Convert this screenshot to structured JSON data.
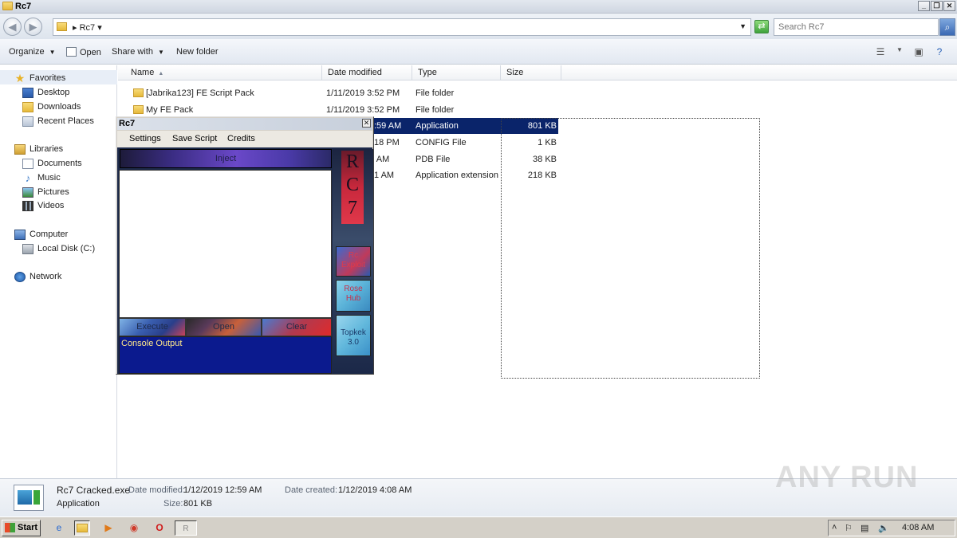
{
  "window": {
    "title": "Rc7"
  },
  "address": {
    "path": "Rc7",
    "search_placeholder": "Search Rc7"
  },
  "toolbar": {
    "organize": "Organize",
    "open": "Open",
    "share_with": "Share with",
    "new_folder": "New folder"
  },
  "nav": {
    "favorites": "Favorites",
    "desktop": "Desktop",
    "downloads": "Downloads",
    "recent": "Recent Places",
    "libraries": "Libraries",
    "documents": "Documents",
    "music": "Music",
    "pictures": "Pictures",
    "videos": "Videos",
    "computer": "Computer",
    "local_disk": "Local Disk (C:)",
    "network": "Network"
  },
  "columns": {
    "name": "Name",
    "date": "Date modified",
    "type": "Type",
    "size": "Size"
  },
  "files": [
    {
      "name": "[Jabrika123] FE Script Pack",
      "date": "1/11/2019 3:52 PM",
      "type": "File folder",
      "size": ""
    },
    {
      "name": "My FE Pack",
      "date": "1/11/2019 3:52 PM",
      "type": "File folder",
      "size": ""
    },
    {
      "name": "",
      "date": ":59 AM",
      "type": "Application",
      "size": "801 KB"
    },
    {
      "name": "",
      "date": "18 PM",
      "type": "CONFIG File",
      "size": "1 KB"
    },
    {
      "name": "",
      "date": ":59 AM",
      "type": "PDB File",
      "size": "38 KB"
    },
    {
      "name": "",
      "date": "1 AM",
      "type": "Application extension",
      "size": "218 KB"
    }
  ],
  "details": {
    "filename": "Rc7 Cracked.exe",
    "filetype": "Application",
    "date_modified_label": "Date modified:",
    "date_modified": "1/12/2019 12:59 AM",
    "date_created_label": "Date created:",
    "date_created": "1/12/2019 4:08 AM",
    "size_label": "Size:",
    "size": "801 KB"
  },
  "watermark": "ANY RUN",
  "taskbar": {
    "start": "Start",
    "clock": "4:08 AM",
    "rc7_task": "R"
  },
  "rc7": {
    "title": "Rc7",
    "menu": {
      "settings": "Settings",
      "save_script": "Save Script",
      "credits": "Credits"
    },
    "inject": "Inject",
    "execute": "Execute",
    "open": "Open",
    "clear": "Clear",
    "console": "Console Output",
    "logo": [
      "R",
      "C",
      "7"
    ],
    "side": {
      "rc_exploit_1": "Rc",
      "rc_exploit_2": "Exploit",
      "rose_1": "Rose",
      "rose_2": "Hub",
      "topkek_1": "Topkek",
      "topkek_2": "3.0"
    }
  }
}
